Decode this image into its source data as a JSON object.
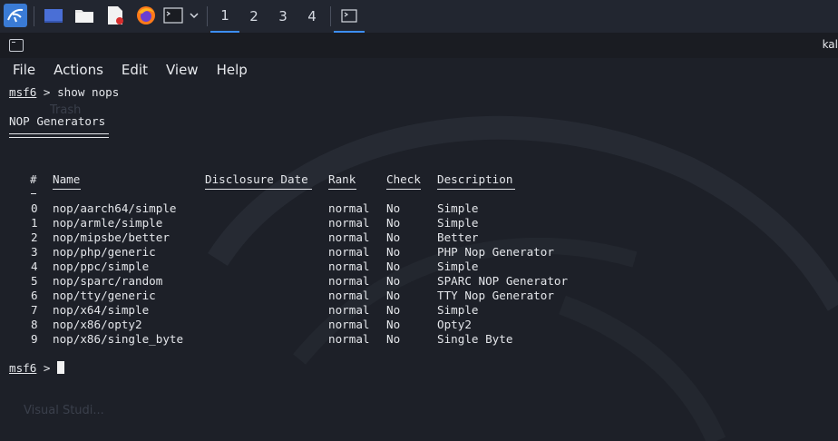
{
  "taskbar": {
    "workspaces": [
      "1",
      "2",
      "3",
      "4"
    ],
    "icons": [
      "kali-menu-icon",
      "desktop-icon",
      "file-manager-icon",
      "text-editor-icon",
      "firefox-icon",
      "terminal-icon",
      "chevron-down-icon",
      "terminal-window-icon"
    ]
  },
  "window": {
    "title": "kal"
  },
  "menu": {
    "file": "File",
    "actions": "Actions",
    "edit": "Edit",
    "view": "View",
    "help": "Help"
  },
  "console": {
    "prompt_name": "msf6",
    "prompt_sym": " > ",
    "command": "show nops",
    "section_title": "NOP Generators",
    "headers": {
      "num": "#",
      "name": "Name",
      "date": "Disclosure Date",
      "rank": "Rank",
      "check": "Check",
      "desc": "Description"
    },
    "rows": [
      {
        "num": "0",
        "name": "nop/aarch64/simple",
        "date": "",
        "rank": "normal",
        "check": "No",
        "desc": "Simple"
      },
      {
        "num": "1",
        "name": "nop/armle/simple",
        "date": "",
        "rank": "normal",
        "check": "No",
        "desc": "Simple"
      },
      {
        "num": "2",
        "name": "nop/mipsbe/better",
        "date": "",
        "rank": "normal",
        "check": "No",
        "desc": "Better"
      },
      {
        "num": "3",
        "name": "nop/php/generic",
        "date": "",
        "rank": "normal",
        "check": "No",
        "desc": "PHP Nop Generator"
      },
      {
        "num": "4",
        "name": "nop/ppc/simple",
        "date": "",
        "rank": "normal",
        "check": "No",
        "desc": "Simple"
      },
      {
        "num": "5",
        "name": "nop/sparc/random",
        "date": "",
        "rank": "normal",
        "check": "No",
        "desc": "SPARC NOP Generator"
      },
      {
        "num": "6",
        "name": "nop/tty/generic",
        "date": "",
        "rank": "normal",
        "check": "No",
        "desc": "TTY Nop Generator"
      },
      {
        "num": "7",
        "name": "nop/x64/simple",
        "date": "",
        "rank": "normal",
        "check": "No",
        "desc": "Simple"
      },
      {
        "num": "8",
        "name": "nop/x86/opty2",
        "date": "",
        "rank": "normal",
        "check": "No",
        "desc": "Opty2"
      },
      {
        "num": "9",
        "name": "nop/x86/single_byte",
        "date": "",
        "rank": "normal",
        "check": "No",
        "desc": "Single Byte"
      }
    ]
  },
  "desktop": {
    "trash": "Trash",
    "vscode": "Visual Studi..."
  },
  "colors": {
    "accent": "#3d8ef5",
    "terminal_bg": "#1d2028",
    "text": "#e4e6ea"
  }
}
